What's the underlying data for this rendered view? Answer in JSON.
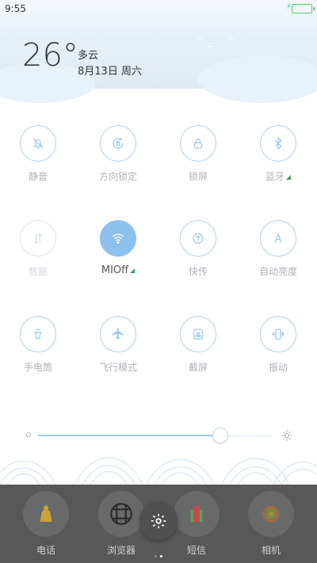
{
  "status_bar": {
    "time": "9:55"
  },
  "weather": {
    "temperature": "26°",
    "condition": "多云",
    "date": "8月13日 周六"
  },
  "toggles": [
    {
      "label": "静音"
    },
    {
      "label": "方向锁定"
    },
    {
      "label": "锁屏"
    },
    {
      "label": "蓝牙"
    },
    {
      "label": "数据"
    },
    {
      "label": "MIOff"
    },
    {
      "label": "快传"
    },
    {
      "label": "自动亮度"
    },
    {
      "label": "手电筒"
    },
    {
      "label": "飞行模式"
    },
    {
      "label": "截屏"
    },
    {
      "label": "振动"
    }
  ],
  "brightness": {
    "level": 0.78
  },
  "dock": {
    "apps": [
      {
        "label": "电话"
      },
      {
        "label": "浏览器"
      },
      {
        "label": "短信"
      },
      {
        "label": "相机"
      }
    ]
  },
  "colors": {
    "accent": "#8ec2ee",
    "tile_border": "#b5d3ef",
    "dock_bg": "#3c3c3c",
    "signal_green": "#3aa35c"
  },
  "page_indicator": {
    "count": 2,
    "current": 2
  }
}
